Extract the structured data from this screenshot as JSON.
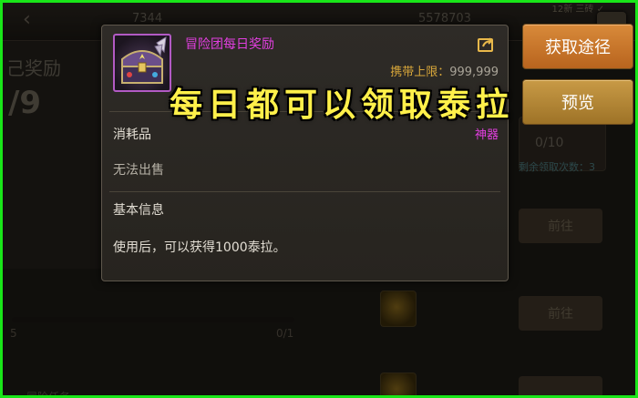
{
  "background": {
    "top_numbers": [
      "7344",
      "5578703"
    ],
    "corner_text": "12新 三砖 ✓",
    "left_title": "己奖励",
    "left_count": "/9",
    "right_count": "0/10",
    "right_teal_text": "剩余领取次数：3",
    "goto_label": "前往",
    "progress_left": "5",
    "progress_right": "0/1",
    "bottom_text": "冒险任务"
  },
  "tooltip": {
    "item_name": "冒险团每日奖励",
    "carry_limit_label": "携带上限：",
    "carry_limit_value": "999,999",
    "rarity": "神器",
    "item_type": "消耗品",
    "sell_status": "无法出售",
    "section_title": "基本信息",
    "description": "使用后，可以获得1000泰拉。"
  },
  "buttons": {
    "obtain": "获取途径",
    "preview": "预览"
  },
  "caption": "每日都可以领取泰拉",
  "colors": {
    "frame": "#19e619",
    "epic_purple": "#e23fe0",
    "gold": "#d8a73a",
    "caption": "#fff04a"
  }
}
